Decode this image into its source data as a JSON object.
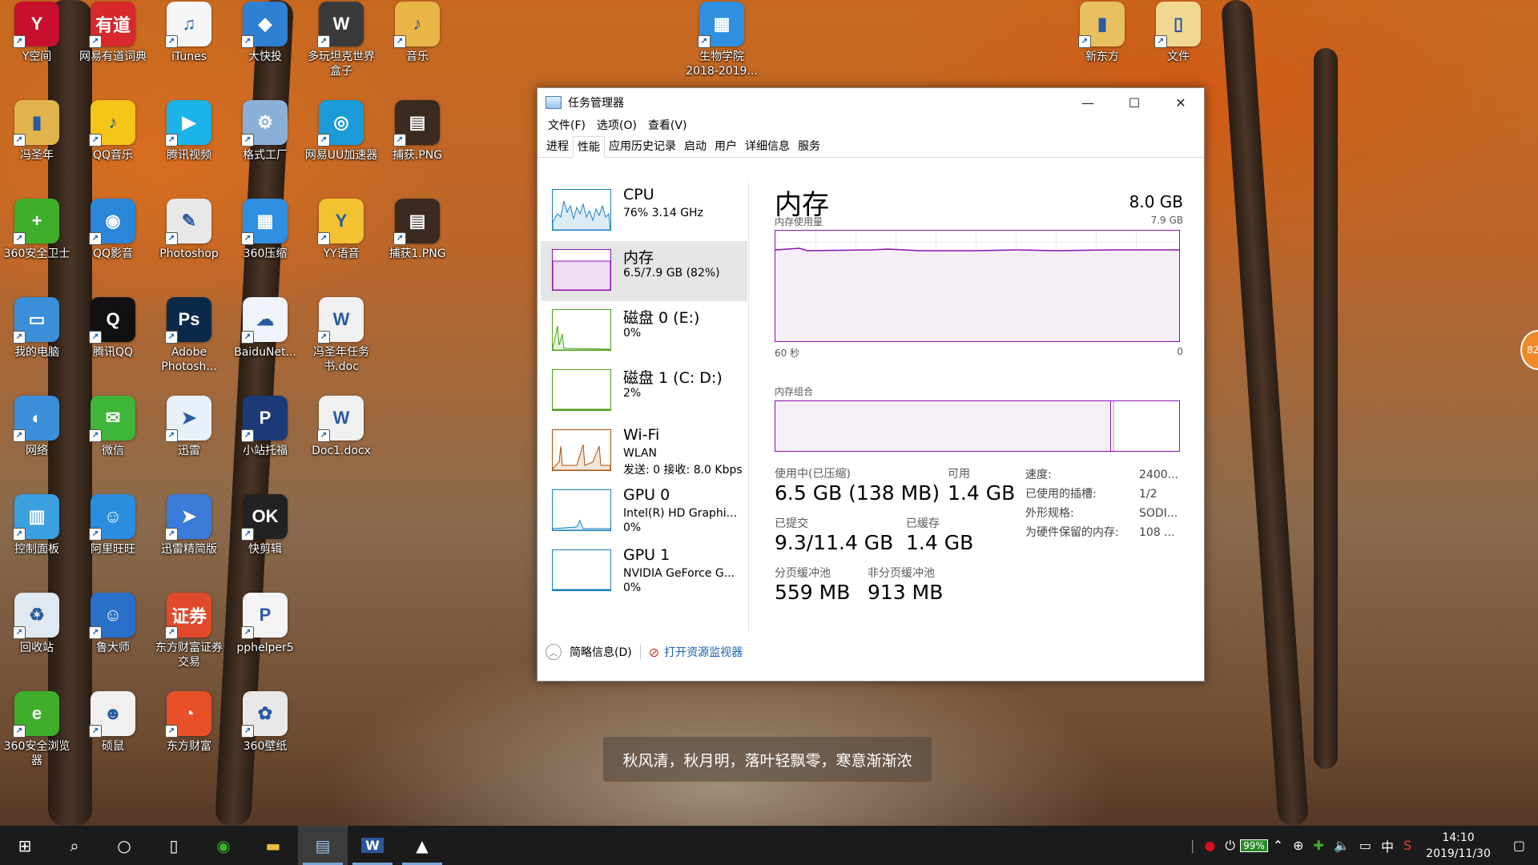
{
  "desktop_icons": [
    {
      "label": "Y空间",
      "color": "#c8102e",
      "glyph": "Y"
    },
    {
      "label": "网易有道词典",
      "color": "#d7282c",
      "glyph": "有道"
    },
    {
      "label": "iTunes",
      "color": "#f5f5f5",
      "glyph": "♫"
    },
    {
      "label": "大快投",
      "color": "#2f7fd3",
      "glyph": "◆"
    },
    {
      "label": "多玩坦克世界盒子",
      "color": "#3a3a3a",
      "glyph": "W"
    },
    {
      "label": "音乐",
      "color": "#e8b546",
      "glyph": "♪"
    },
    {
      "label": "冯圣年",
      "color": "#e0b44a",
      "glyph": "▮"
    },
    {
      "label": "QQ音乐",
      "color": "#f5c518",
      "glyph": "♪"
    },
    {
      "label": "腾讯视频",
      "color": "#1cb4e8",
      "glyph": "▶"
    },
    {
      "label": "格式工厂",
      "color": "#8ab0d8",
      "glyph": "⚙"
    },
    {
      "label": "网易UU加速器",
      "color": "#1a9bd7",
      "glyph": "◎"
    },
    {
      "label": "捕获.PNG",
      "color": "#3a2a20",
      "glyph": "▤"
    },
    {
      "label": "360安全卫士",
      "color": "#3fae2a",
      "glyph": "+"
    },
    {
      "label": "QQ影音",
      "color": "#2a86d8",
      "glyph": "◉"
    },
    {
      "label": "Photoshop",
      "color": "#e8e8e8",
      "glyph": "✎"
    },
    {
      "label": "360压缩",
      "color": "#2f8fe0",
      "glyph": "▦"
    },
    {
      "label": "YY语音",
      "color": "#f2c230",
      "glyph": "Y"
    },
    {
      "label": "捕获1.PNG",
      "color": "#3a2a20",
      "glyph": "▤"
    },
    {
      "label": "我的电脑",
      "color": "#3a8fd8",
      "glyph": "▭"
    },
    {
      "label": "腾讯QQ",
      "color": "#111111",
      "glyph": "Q"
    },
    {
      "label": "Adobe Photosh...",
      "color": "#0b2a4a",
      "glyph": "Ps"
    },
    {
      "label": "BaiduNet...",
      "color": "#f0f4fa",
      "glyph": "☁"
    },
    {
      "label": "冯圣年任务书.doc",
      "color": "#f0f0f0",
      "glyph": "W"
    },
    {
      "label": "网络",
      "color": "#3a8fd8",
      "glyph": "◐"
    },
    {
      "label": "微信",
      "color": "#3fb53a",
      "glyph": "✉"
    },
    {
      "label": "迅雷",
      "color": "#e8f0fa",
      "glyph": "➤"
    },
    {
      "label": "小站托福",
      "color": "#1d3a78",
      "glyph": "P"
    },
    {
      "label": "Doc1.docx",
      "color": "#f0f0f0",
      "glyph": "W"
    },
    {
      "label": "控制面板",
      "color": "#3aa0e0",
      "glyph": "▥"
    },
    {
      "label": "阿里旺旺",
      "color": "#2a8de0",
      "glyph": "☺"
    },
    {
      "label": "迅雷精简版",
      "color": "#3a7ad8",
      "glyph": "➤"
    },
    {
      "label": "快剪辑",
      "color": "#222222",
      "glyph": "OK"
    },
    {
      "label": "回收站",
      "color": "#e0e8f0",
      "glyph": "♻"
    },
    {
      "label": "鲁大师",
      "color": "#2a70c8",
      "glyph": "☺"
    },
    {
      "label": "东方财富证券交易",
      "color": "#e04a2a",
      "glyph": "证券"
    },
    {
      "label": "pphelper5",
      "color": "#f4f4f4",
      "glyph": "P"
    },
    {
      "label": "360安全浏览器",
      "color": "#3fae2a",
      "glyph": "e"
    },
    {
      "label": "硕鼠",
      "color": "#f0f0f0",
      "glyph": "☻"
    },
    {
      "label": "东方财富",
      "color": "#e8502a",
      "glyph": "◔"
    },
    {
      "label": "360壁纸",
      "color": "#e8e8e8",
      "glyph": "✿"
    },
    {
      "label": "生物学院2018-2019...",
      "color": "#2f8fe0",
      "glyph": "▦"
    },
    {
      "label": "新东方",
      "color": "#e8c060",
      "glyph": "▮"
    },
    {
      "label": "文件",
      "color": "#f0d890",
      "glyph": "▯"
    }
  ],
  "tm": {
    "title": "任务管理器",
    "controls": {
      "minimize": "—",
      "maximize": "☐",
      "close": "✕"
    },
    "menu": [
      "文件(F)",
      "选项(O)",
      "查看(V)"
    ],
    "tabs": [
      "进程",
      "性能",
      "应用历史记录",
      "启动",
      "用户",
      "详细信息",
      "服务"
    ],
    "active_tab": "性能",
    "side": [
      {
        "title": "CPU",
        "l2": "76%  3.14 GHz",
        "l3": "",
        "color": "#1780c0"
      },
      {
        "title": "内存",
        "l2": "6.5/7.9 GB (82%)",
        "l3": "",
        "color": "#8b12ae"
      },
      {
        "title": "磁盘 0 (E:)",
        "l2": "0%",
        "l3": "",
        "color": "#4da01a"
      },
      {
        "title": "磁盘 1 (C: D:)",
        "l2": "2%",
        "l3": "",
        "color": "#4da01a"
      },
      {
        "title": "Wi-Fi",
        "l2": "WLAN",
        "l3": "发送: 0 接收: 8.0 Kbps",
        "color": "#a7500c"
      },
      {
        "title": "GPU 0",
        "l2": "Intel(R) HD Graphi...",
        "l3": "0%",
        "color": "#1780c0"
      },
      {
        "title": "GPU 1",
        "l2": "NVIDIA GeForce G...",
        "l3": "0%",
        "color": "#1780c0"
      }
    ],
    "main": {
      "title": "内存",
      "capacity": "8.0 GB",
      "usage_label": "内存使用量",
      "usage_max": "7.9 GB",
      "axis_left": "60 秒",
      "axis_right": "0",
      "composition_label": "内存组合",
      "stats": {
        "in_use_label": "使用中(已压缩)",
        "in_use": "6.5 GB (138 MB)",
        "available_label": "可用",
        "available": "1.4 GB",
        "committed_label": "已提交",
        "committed": "9.3/11.4 GB",
        "cached_label": "已缓存",
        "cached": "1.4 GB",
        "paged_label": "分页缓冲池",
        "paged": "559 MB",
        "nonpaged_label": "非分页缓冲池",
        "nonpaged": "913 MB"
      },
      "specs": [
        {
          "k": "速度:",
          "v": "2400..."
        },
        {
          "k": "已使用的插槽:",
          "v": "1/2"
        },
        {
          "k": "外形规格:",
          "v": "SODI..."
        },
        {
          "k": "为硬件保留的内存:",
          "v": "108 ..."
        }
      ]
    },
    "footer": {
      "less": "简略信息(D)",
      "monitor": "打开资源监视器"
    }
  },
  "caption": "秋风清，秋月明，落叶轻飘零，寒意渐渐浓",
  "side_badge": "82",
  "taskbar": {
    "battery": "99%",
    "ime": "中",
    "time": "14:10",
    "date": "2019/11/30"
  }
}
